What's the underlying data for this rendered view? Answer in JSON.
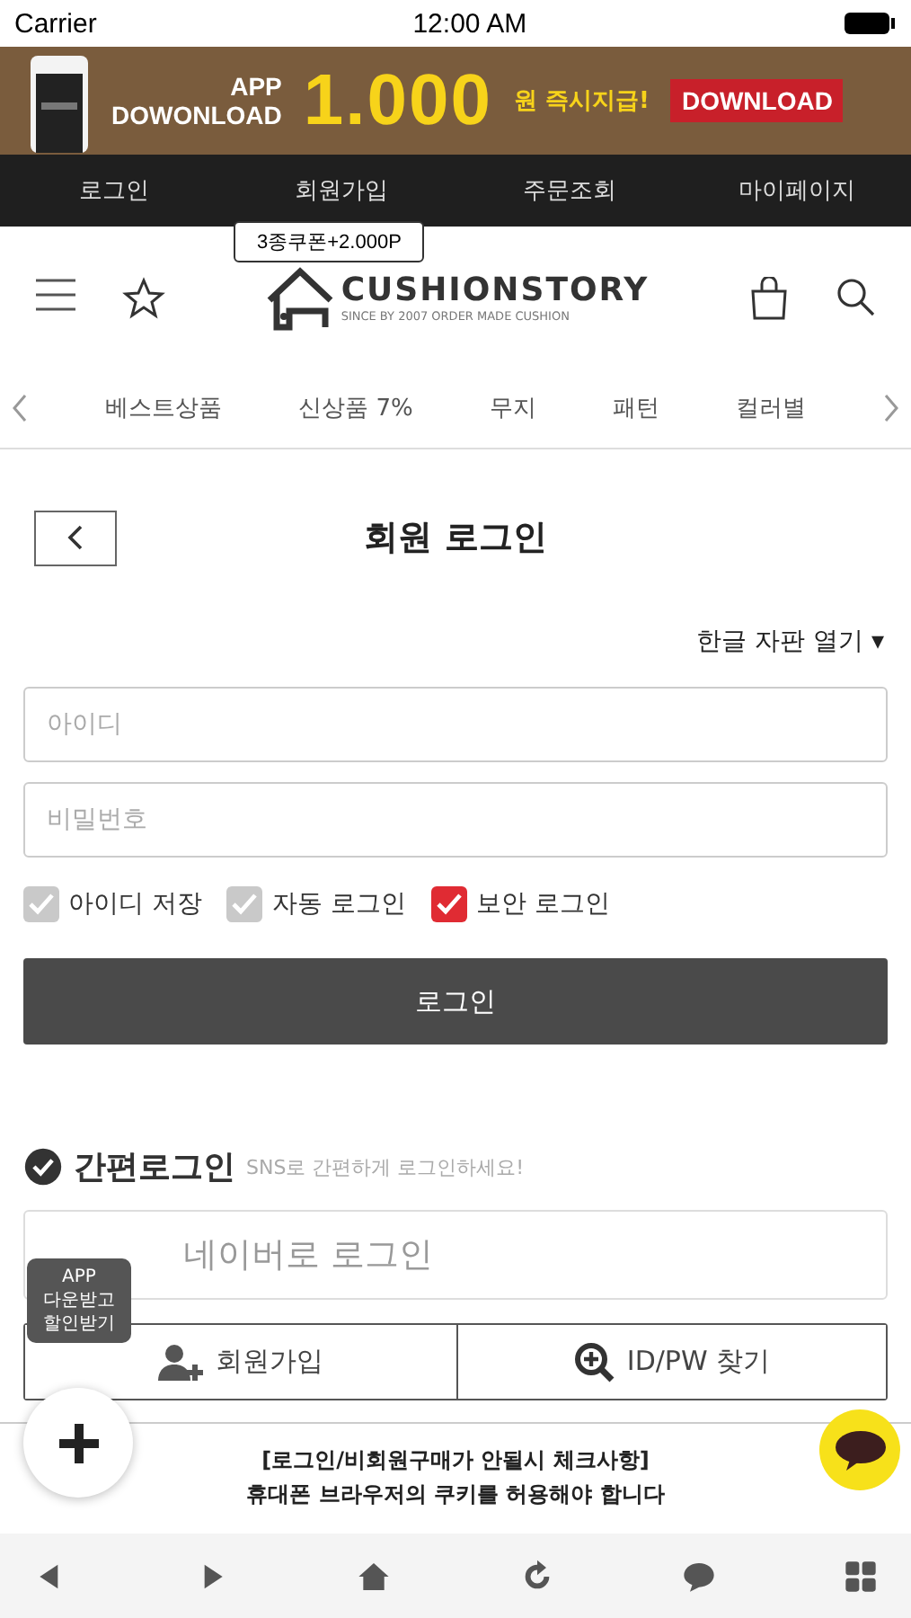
{
  "status_bar": {
    "carrier": "Carrier",
    "time": "12:00 AM"
  },
  "banner": {
    "app_text": "APP\nDOWONLOAD",
    "amount": "1.000",
    "suffix": "원 즉시지급!",
    "button": "DOWNLOAD"
  },
  "top_nav": [
    "로그인",
    "회원가입",
    "주문조회",
    "마이페이지"
  ],
  "coupon_badge": "3종쿠폰+2.000P",
  "logo": {
    "name": "CUSHIONSTORY",
    "tagline": "SINCE BY 2007 ORDER MADE CUSHION"
  },
  "categories": [
    "베스트상품",
    "신상품 7%",
    "무지",
    "패턴",
    "컬러별"
  ],
  "page_title": "회원 로그인",
  "keyboard_toggle": "한글 자판 열기 ▾",
  "fields": [
    {
      "placeholder": "아이디"
    },
    {
      "placeholder": "비밀번호"
    }
  ],
  "options": [
    {
      "label": "아이디 저장",
      "checked": false
    },
    {
      "label": "자동 로그인",
      "checked": false
    },
    {
      "label": "보안 로그인",
      "checked": true
    }
  ],
  "login_button": "로그인",
  "easy_login": {
    "title": "간편로그인",
    "subtitle": "SNS로 간편하게 로그인하세요!",
    "naver": "네이버로 로그인"
  },
  "actions": [
    {
      "kind": "join",
      "label": "회원가입"
    },
    {
      "kind": "find",
      "label": "ID/PW 찾기"
    }
  ],
  "app_badge": "APP\n다운받고\n할인받기",
  "notice": [
    "[로그인/비회원구매가 안될시 체크사항]",
    "휴대폰 브라우저의 쿠키를 허용해야 합니다"
  ]
}
